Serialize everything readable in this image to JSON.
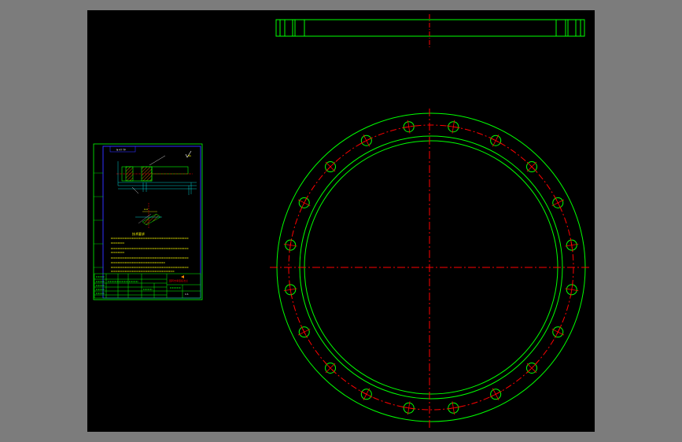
{
  "colors": {
    "frame_bg": "#7c7c7c",
    "canvas_bg": "#000000",
    "outline": "#00ff00",
    "centerline": "#ff0000",
    "sheet_border": "#3030ff",
    "dim": "#00ffff",
    "hatch": "#ff8800",
    "note_text": "#ffff00"
  },
  "drawing": {
    "bolt_hole_count": 20,
    "detail_label": "A-A",
    "rough_label": "Ra",
    "sheet_title": "技术要求",
    "title_block_name": "回转支承连接法兰",
    "title_block_scale": "1:1"
  }
}
